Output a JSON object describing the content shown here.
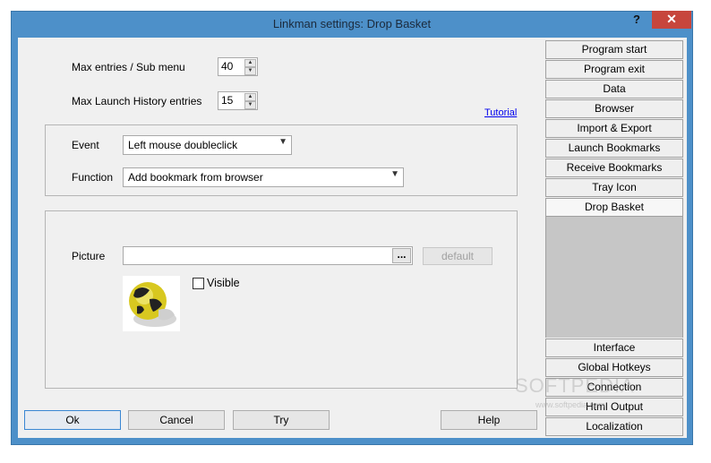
{
  "window": {
    "title": "Linkman settings: Drop Basket",
    "help_glyph": "?",
    "close_glyph": "✕"
  },
  "fields": {
    "max_entries_label": "Max entries / Sub menu",
    "max_entries_value": "40",
    "max_history_label": "Max Launch History entries",
    "max_history_value": "15",
    "tutorial_link": "Tutorial"
  },
  "event_group": {
    "event_label": "Event",
    "event_value": "Left mouse doubleclick",
    "function_label": "Function",
    "function_value": "Add bookmark from browser"
  },
  "picture_group": {
    "picture_label": "Picture",
    "picture_value": "",
    "browse_label": "...",
    "default_label": "default",
    "visible_label": "Visible",
    "visible_checked": false
  },
  "nav": {
    "top_items": [
      "Program start",
      "Program exit",
      "Data",
      "Browser",
      "Import & Export",
      "Launch Bookmarks",
      "Receive Bookmarks",
      "Tray Icon",
      "Drop Basket"
    ],
    "bottom_items": [
      "Interface",
      "Global Hotkeys",
      "Connection",
      "Html Output",
      "Localization"
    ],
    "active": "Drop Basket"
  },
  "buttons": {
    "ok": "Ok",
    "cancel": "Cancel",
    "try": "Try",
    "help": "Help"
  },
  "watermark": {
    "main": "SOFTPEDIA",
    "sub": "www.softpedia.com"
  },
  "colors": {
    "frame": "#4d90c9",
    "close": "#c7463c",
    "link": "#0000ee"
  }
}
